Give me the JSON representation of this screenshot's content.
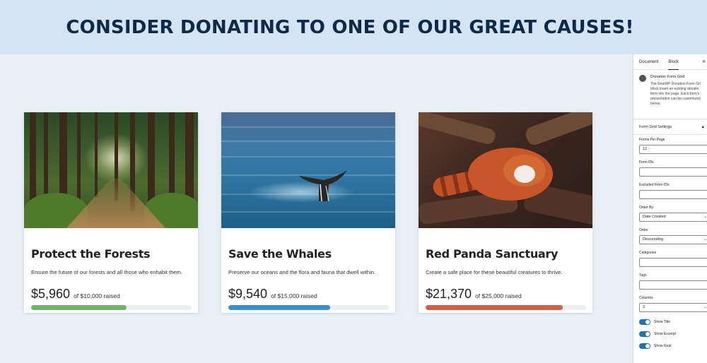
{
  "banner": {
    "heading": "CONSIDER DONATING TO ONE OF OUR GREAT CAUSES!"
  },
  "cards": [
    {
      "title": "Protect the Forests",
      "excerpt": "Ensure the future of our forests and all those who enhabit them.",
      "raised": "$5,960",
      "goal_text": "of $10,000 raised",
      "progress": 0.596,
      "color": "#6db56d",
      "image": "forest-image"
    },
    {
      "title": "Save the Whales",
      "excerpt": "Preserve our oceans and the flora and fauna that dwell within.",
      "raised": "$9,540",
      "goal_text": "of $15,000 raised",
      "progress": 0.636,
      "color": "#3a8fd1",
      "image": "whale-tail-image"
    },
    {
      "title": "Red Panda Sanctuary",
      "excerpt": "Create a safe place for these beautiful creatures to thrive.",
      "raised": "$21,370",
      "goal_text": "of $25,000 raised",
      "progress": 0.855,
      "color": "#d35f46",
      "image": "red-panda-image"
    }
  ],
  "sidebar": {
    "tabs": [
      "Document",
      "Block"
    ],
    "active_tab": "Block",
    "block": {
      "title": "Donation Form Grid",
      "desc_lines": [
        "The GiveWP Donation Form Gri",
        "block insert an existing donatio",
        "form into the page. Each form's",
        "presentation can be customized",
        "below."
      ]
    },
    "panel_title": "Form Grid Settings",
    "fields": {
      "forms_per_page": {
        "label": "Forms Per Page",
        "value": "12"
      },
      "form_ids": {
        "label": "Form IDs",
        "value": ""
      },
      "excluded_form_ids": {
        "label": "Excluded Form IDs",
        "value": ""
      },
      "order_by": {
        "label": "Order By",
        "value": "Date Created"
      },
      "order": {
        "label": "Order",
        "value": "Descending"
      },
      "categories": {
        "label": "Categories",
        "value": ""
      },
      "tags": {
        "label": "Tags",
        "value": ""
      },
      "columns": {
        "label": "Columns",
        "value": "3"
      }
    },
    "toggles": [
      {
        "label": "Show Title",
        "on": true
      },
      {
        "label": "Show Excerpt",
        "on": true
      },
      {
        "label": "Show Goal",
        "on": true
      }
    ]
  }
}
